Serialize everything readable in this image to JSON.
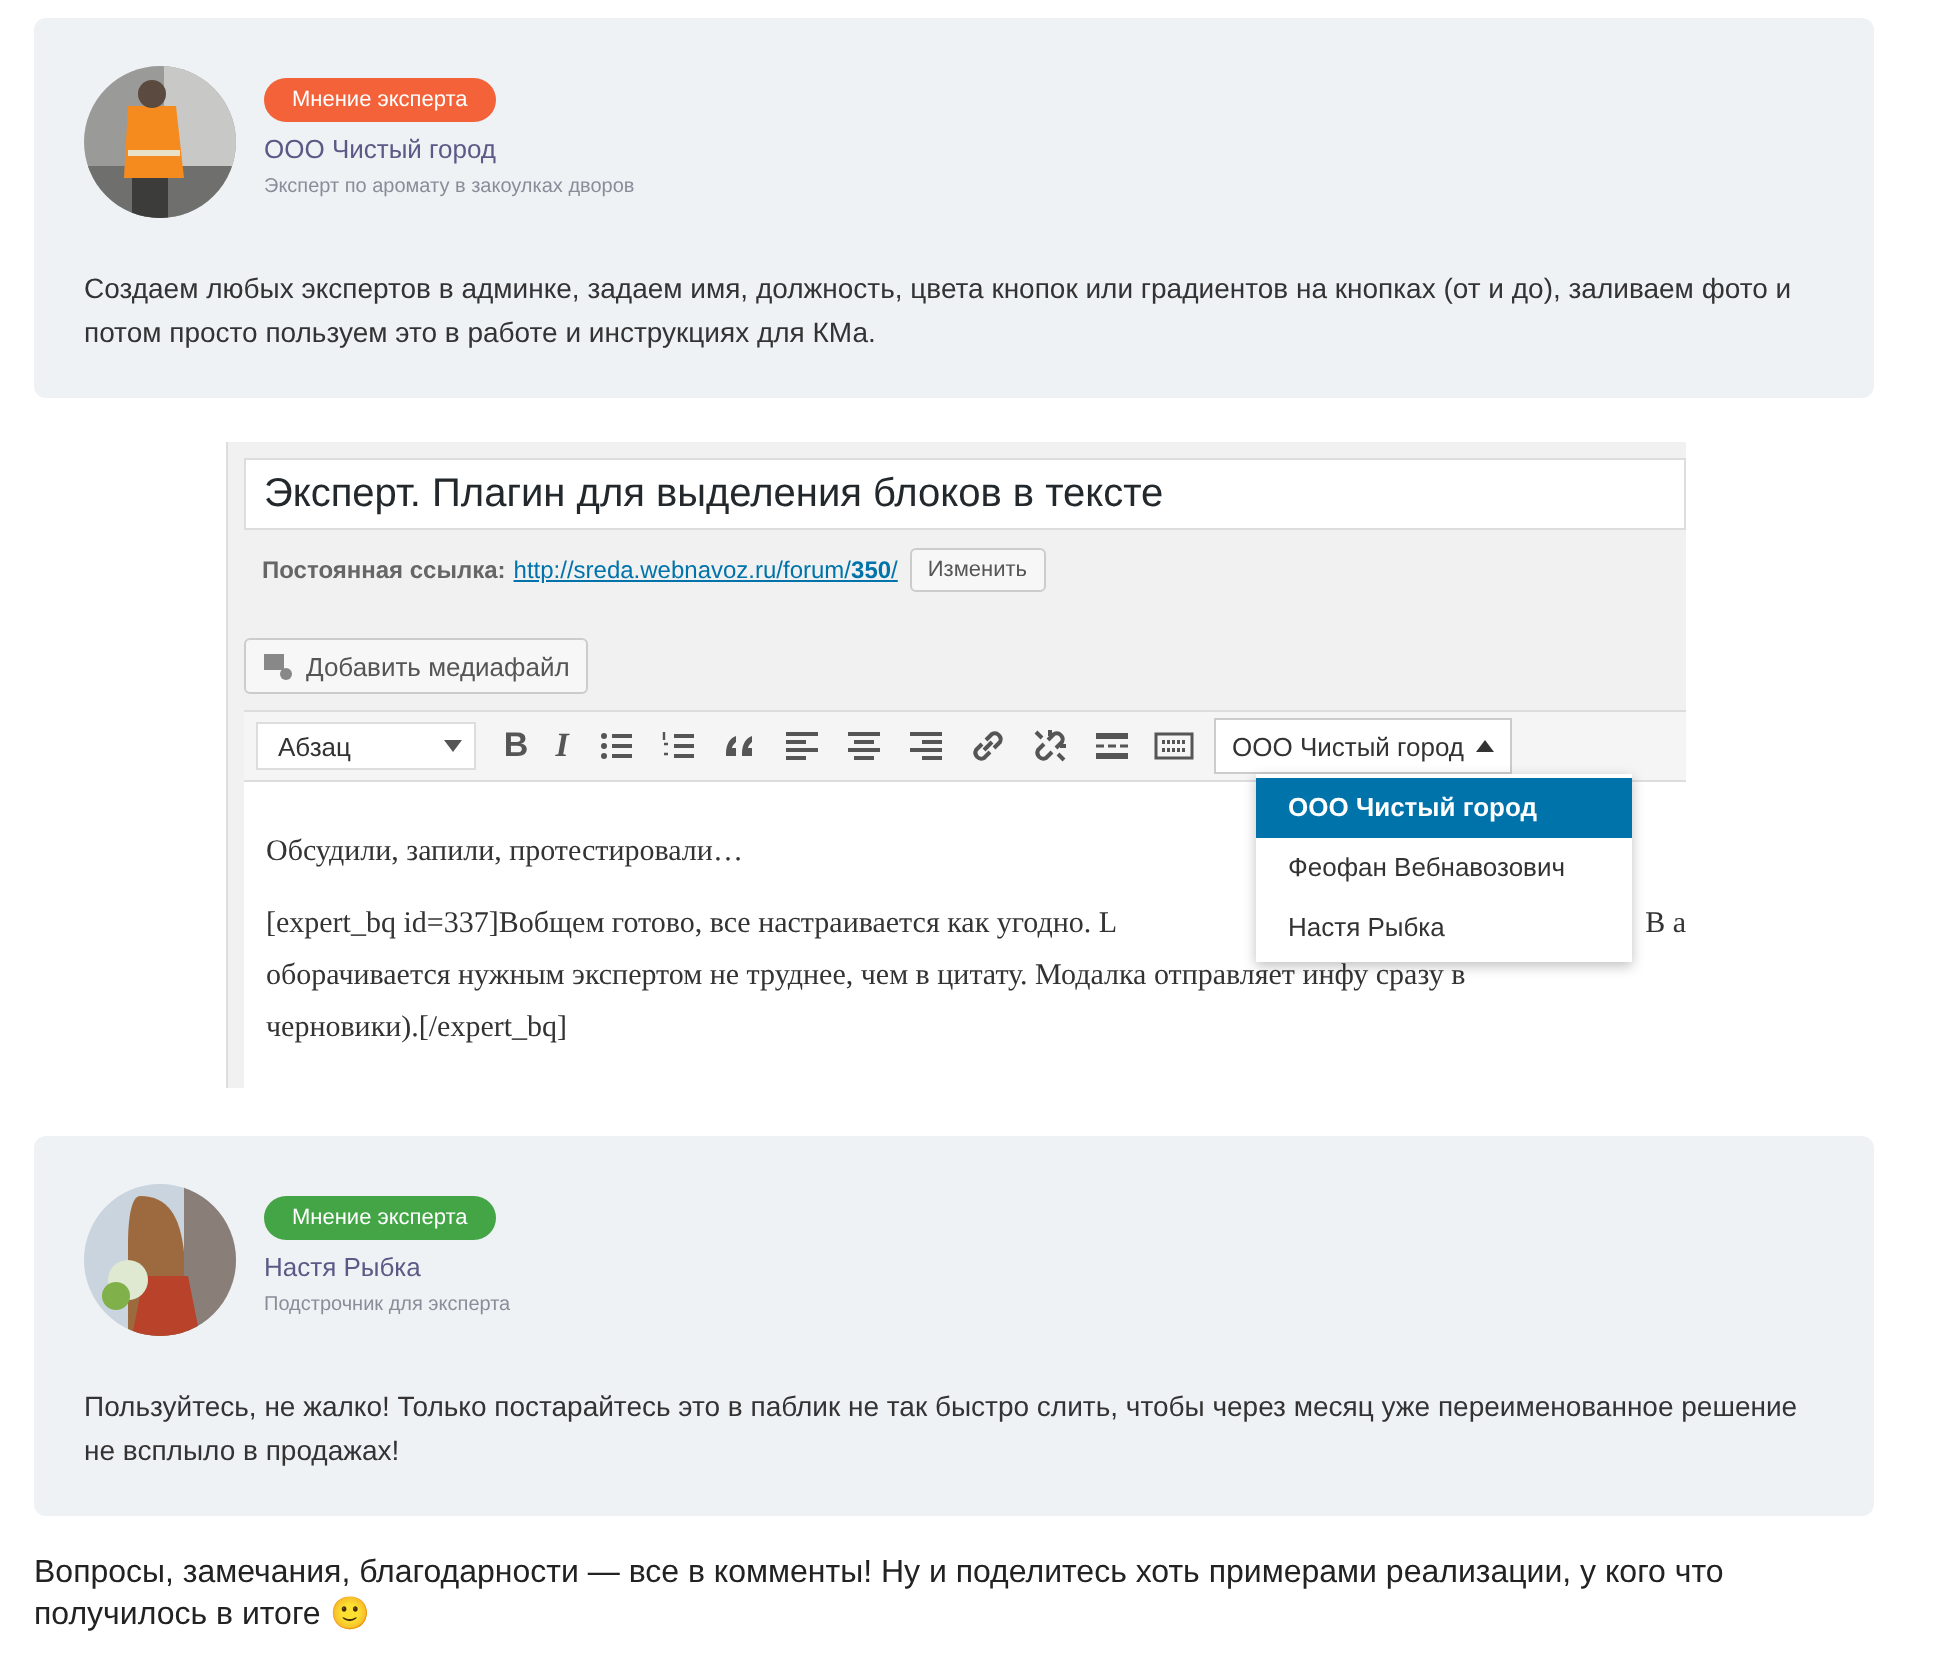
{
  "experts": [
    {
      "badge": "Мнение эксперта",
      "color": "#f4623a",
      "name": "ООО Чистый город",
      "role": "Эксперт по аромату в закоулках дворов",
      "text": "Создаем любых экспертов в админке, задаем имя, должность, цвета кнопок или градиентов на кнопках (от и до), заливаем фото и потом просто пользуем это в работе и инструкциях для КМа."
    },
    {
      "badge": "Мнение эксперта",
      "color": "#43a546",
      "name": "Настя Рыбка",
      "role": "Подстрочник для эксперта",
      "text": "Пользуйтесь, не жалко! Только постарайтесь это в паблик не так быстро слить, чтобы через месяц уже переименованное решение не всплыло в продажах!"
    }
  ],
  "editor": {
    "title": "Эксперт. Плагин для выделения блоков в тексте",
    "permalink_label": "Постоянная ссылка:",
    "permalink_url": "http://sreda.webnavoz.ru/forum/",
    "permalink_slug": "350",
    "permalink_suffix": "/",
    "edit_button": "Изменить",
    "media_button": "Добавить медиафайл",
    "format_select": "Абзац",
    "tools": [
      {
        "kind": "bold",
        "label": "B"
      },
      {
        "kind": "italic",
        "label": "I"
      },
      {
        "kind": "bullets"
      },
      {
        "kind": "numbers"
      },
      {
        "kind": "quote"
      },
      {
        "kind": "align-left"
      },
      {
        "kind": "align-center"
      },
      {
        "kind": "align-right"
      },
      {
        "kind": "link"
      },
      {
        "kind": "unlink"
      },
      {
        "kind": "more"
      },
      {
        "kind": "keyboard"
      }
    ],
    "expert_select": "ООО Чистый город",
    "dropdown": [
      {
        "label": "ООО Чистый город",
        "selected": true
      },
      {
        "label": "Феофан Вебнавозович",
        "selected": false
      },
      {
        "label": "Настя Рыбка",
        "selected": false
      }
    ],
    "body": [
      "Обсудили, запили, протестировали…"
    ],
    "shortcode_lines": [
      {
        "left": "[expert_bq id=337]Вобщем готово, все настраивается как угодно. L",
        "right": "В а"
      },
      {
        "left": "оборачивается нужным экспертом не труднее, чем в цитату. Модалка отправляет инфу сразу в"
      },
      {
        "left": "черновики).[/expert_bq]"
      }
    ]
  },
  "footer_text": "Вопросы, замечания, благодарности — все в комменты! Ну и поделитесь хоть примерами реализации, у кого что получилось в итоге 🙂"
}
